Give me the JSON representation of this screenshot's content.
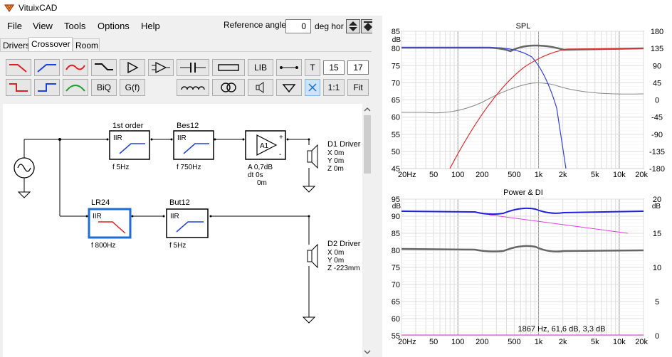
{
  "window": {
    "title": "VituixCAD"
  },
  "menu": [
    "File",
    "View",
    "Tools",
    "Options",
    "Help"
  ],
  "reference": {
    "label": "Reference angle",
    "value": "0",
    "unit": "deg hor"
  },
  "tabs": [
    {
      "label": "Drivers",
      "active": false
    },
    {
      "label": "Crossover",
      "active": true
    },
    {
      "label": "Room",
      "active": false
    }
  ],
  "toolbar": {
    "lib": "LIB",
    "t": "T",
    "biq": "BiQ",
    "gf": "G(f)",
    "ratio": "1:1",
    "fit": "Fit",
    "num1": "15",
    "num2": "17"
  },
  "schematic": {
    "blocks": {
      "b1": {
        "title": "1st order",
        "type": "IIR",
        "param": "f  5Hz"
      },
      "b2": {
        "title": "Bes12",
        "type": "IIR",
        "param": "f  750Hz"
      },
      "amp": {
        "label": "A1",
        "line1": "A  0,7dB",
        "line2": "dt 0s",
        "line3": "0m",
        "plus": "+",
        "minus": "-"
      },
      "b3": {
        "title": "LR24",
        "type": "IIR",
        "param": "f  800Hz"
      },
      "b4": {
        "title": "But12",
        "type": "IIR",
        "param": "f  5Hz"
      }
    },
    "drivers": {
      "d1": {
        "name": "D1 Driver",
        "x": "X 0m",
        "y": "Y 0m",
        "z": "Z 0m"
      },
      "d2": {
        "name": "D2 Driver",
        "x": "X 0m",
        "y": "Y 0m",
        "z": "Z -223mm"
      }
    }
  },
  "graphs": {
    "spl": {
      "title": "SPL",
      "y_unit": "dB",
      "y_ticks": [
        "85",
        "80",
        "75",
        "70",
        "65",
        "60",
        "55",
        "50",
        "45"
      ],
      "y2_ticks": [
        "180",
        "135",
        "90",
        "45",
        "0",
        "-45",
        "-90",
        "-135",
        "-180"
      ],
      "x_ticks": [
        "20Hz",
        "50",
        "100",
        "200",
        "500",
        "1k",
        "2k",
        "5k",
        "10k",
        "20k"
      ]
    },
    "power": {
      "title": "Power & DI",
      "y_unit": "dB",
      "y_ticks": [
        "95",
        "90",
        "85",
        "80",
        "75",
        "70",
        "65",
        "60",
        "55"
      ],
      "y2_unit": "dB",
      "y2_ticks": [
        "20",
        "15",
        "10",
        "5",
        "0"
      ],
      "x_ticks": [
        "20Hz",
        "50",
        "100",
        "200",
        "500",
        "1k",
        "2k",
        "5k",
        "10k",
        "20k"
      ],
      "readout": "1867 Hz, 61,6 dB, 3,3 dB"
    }
  },
  "colors": {
    "total": "#666666",
    "lowpass": "#3040e0",
    "highpass": "#e03030",
    "power": "#2020e0",
    "di": "#e040e0",
    "highlight": "#1a6fd6"
  }
}
